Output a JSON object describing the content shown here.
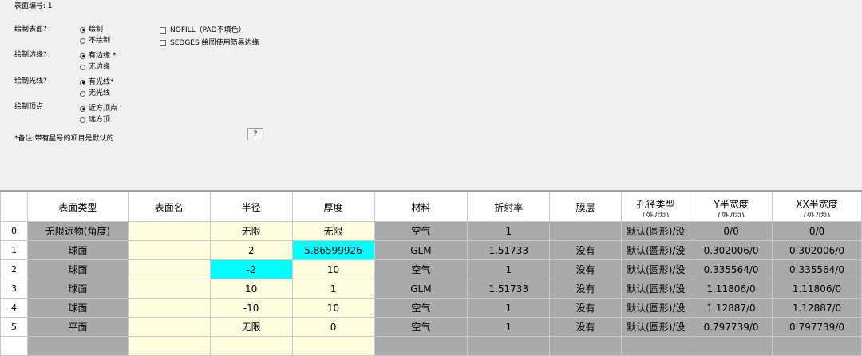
{
  "options": {
    "surface_number_label": "表面编号: 1",
    "draw_surface": {
      "label": "绘制表面?",
      "opt1": "绘制",
      "opt2": "不绘制"
    },
    "draw_edges": {
      "label": "绘制边缘?",
      "opt1": "有边缘 *",
      "opt2": "无边缘"
    },
    "draw_rays": {
      "label": "绘制光线?",
      "opt1": "有光线*",
      "opt2": "无光线"
    },
    "draw_vertex": {
      "label": "绘制顶点",
      "opt1": "近方顶点 ‘",
      "opt2": "远方顶"
    },
    "nofill_label": "NOFILL（PAD不填色）",
    "sedges_label": "SEDGES 绘图使用简易边缘",
    "note": "*备注:带有星号的项目是默认的",
    "help_button": "?"
  },
  "table": {
    "headers": [
      "表面类型",
      "表面名",
      "半径",
      "厚度",
      "材料",
      "折射率",
      "膜层",
      "孔径类型",
      "Y半宽度",
      "XX半宽度"
    ],
    "header_sub": [
      "",
      "",
      "",
      "",
      "",
      "",
      "",
      "(外/内)",
      "(外/内)",
      "(外/内)"
    ],
    "rows": [
      {
        "num": "0",
        "type": "无限远物(角度)",
        "name": "",
        "radius": "无限",
        "thickness": "无限",
        "material": "空气",
        "index": "1",
        "coating": "",
        "aperture": "默认(圆形)/没",
        "ysemi": "0/0",
        "xsemi": "0/0"
      },
      {
        "num": "1",
        "type": "球面",
        "name": "",
        "radius": "2",
        "thickness": "5.86599926",
        "material": "GLM",
        "index": "1.51733",
        "coating": "没有",
        "aperture": "默认(圆形)/没",
        "ysemi": "0.302006/0",
        "xsemi": "0.302006/0"
      },
      {
        "num": "2",
        "type": "球面",
        "name": "",
        "radius": "-2",
        "thickness": "10",
        "material": "空气",
        "index": "1",
        "coating": "没有",
        "aperture": "默认(圆形)/没",
        "ysemi": "0.335564/0",
        "xsemi": "0.335564/0"
      },
      {
        "num": "3",
        "type": "球面",
        "name": "",
        "radius": "10",
        "thickness": "1",
        "material": "GLM",
        "index": "1.51733",
        "coating": "没有",
        "aperture": "默认(圆形)/没",
        "ysemi": "1.11806/0",
        "xsemi": "1.11806/0"
      },
      {
        "num": "4",
        "type": "球面",
        "name": "",
        "radius": "-10",
        "thickness": "10",
        "material": "空气",
        "index": "1",
        "coating": "没有",
        "aperture": "默认(圆形)/没",
        "ysemi": "1.12887/0",
        "xsemi": "1.12887/0"
      },
      {
        "num": "5",
        "type": "平面",
        "name": "",
        "radius": "无限",
        "thickness": "0",
        "material": "空气",
        "index": "1",
        "coating": "没有",
        "aperture": "默认(圆形)/没",
        "ysemi": "0.797739/0",
        "xsemi": "0.797739/0"
      }
    ]
  },
  "colors": {
    "gray_cell": "#a9a9a9",
    "cream_cell": "#fffde0",
    "highlight_cell": "#00ffff",
    "panel_bg": "#f0f0f0"
  }
}
